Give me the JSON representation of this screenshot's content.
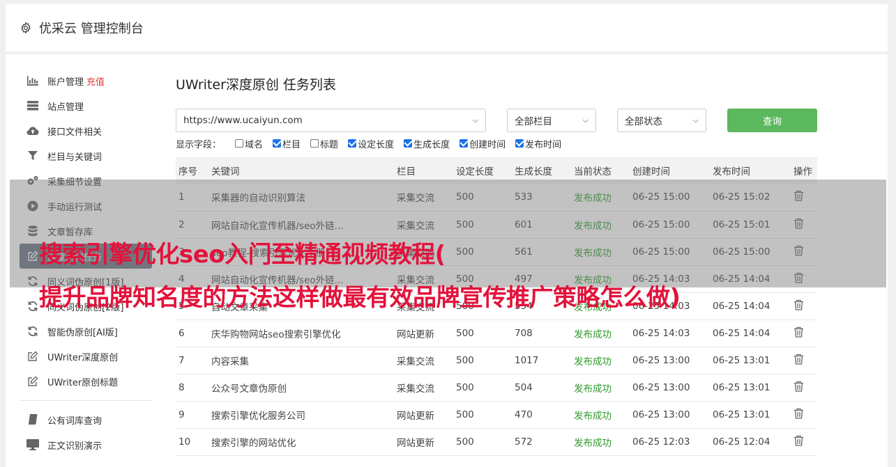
{
  "header": {
    "title": "优采云 管理控制台",
    "icon": "gear-icon"
  },
  "sidebar": {
    "items": [
      {
        "label": "账户管理",
        "extra": "充值",
        "icon": "bar-chart-icon"
      },
      {
        "label": "站点管理",
        "icon": "server-icon"
      },
      {
        "label": "接口文件相关",
        "icon": "cloud-upload-icon"
      },
      {
        "label": "栏目与关键词",
        "icon": "filter-icon"
      },
      {
        "label": "采集细节设置",
        "icon": "gears-icon"
      },
      {
        "label": "手动运行测试",
        "icon": "play-icon"
      },
      {
        "label": "文章暂存库",
        "icon": "database-icon"
      },
      {
        "label": "深度原创任务",
        "icon": "edit-icon",
        "active": true
      },
      {
        "label": "同义词伪原创[1版]",
        "icon": "refresh-icon"
      },
      {
        "label": "同义词伪原创[2版]",
        "icon": "refresh-icon"
      },
      {
        "label": "智能伪原创[AI版]",
        "icon": "refresh-icon"
      },
      {
        "label": "UWriter深度原创",
        "icon": "edit-icon"
      },
      {
        "label": "UWriter原创标题",
        "icon": "edit-icon"
      },
      {
        "label": "公有词库查询",
        "icon": "book-icon"
      },
      {
        "label": "正文识别演示",
        "icon": "monitor-icon"
      }
    ]
  },
  "main": {
    "title": "UWriter深度原创 任务列表",
    "site_select": "https://www.ucaiyun.com",
    "column_select": "全部栏目",
    "status_select": "全部状态",
    "query_label": "查询",
    "fields_label": "显示字段：",
    "fields": [
      {
        "label": "域名",
        "checked": false
      },
      {
        "label": "栏目",
        "checked": true
      },
      {
        "label": "标题",
        "checked": false
      },
      {
        "label": "设定长度",
        "checked": true
      },
      {
        "label": "生成长度",
        "checked": true
      },
      {
        "label": "创建时间",
        "checked": true
      },
      {
        "label": "发布时间",
        "checked": true
      }
    ],
    "columns": [
      "序号",
      "关键词",
      "栏目",
      "设定长度",
      "生成长度",
      "当前状态",
      "创建时间",
      "发布时间",
      "操作"
    ],
    "rows": [
      [
        "1",
        "采集器的自动识别算法",
        "采集交流",
        "500",
        "533",
        "发布成功",
        "06-25 15:00",
        "06-25 15:02"
      ],
      [
        "2",
        "网站自动化宣传机器/seo外链...",
        "采集交流",
        "500",
        "601",
        "发布成功",
        "06-25 15:00",
        "06-25 15:01"
      ],
      [
        "3",
        "seo教程-搜索引擎优化手册",
        "采集交流",
        "500",
        "561",
        "发布成功",
        "06-25 15:00",
        "06-25 15:00"
      ],
      [
        "4",
        "网站自动化宣传机器/seo外链...",
        "采集交流",
        "500",
        "497",
        "发布成功",
        "06-25 14:03",
        "06-25 14:04"
      ],
      [
        "5",
        "自动文章采集",
        "采集交流",
        "500",
        "554",
        "发布成功",
        "06-25 14:03",
        "06-25 14:04"
      ],
      [
        "6",
        "庆华购物网站seo搜索引擎优化",
        "网站更新",
        "500",
        "708",
        "发布成功",
        "06-25 14:03",
        "06-25 14:04"
      ],
      [
        "7",
        "内容采集",
        "采集交流",
        "500",
        "1017",
        "发布成功",
        "06-25 13:00",
        "06-25 13:01"
      ],
      [
        "8",
        "公众号文章伪原创",
        "采集交流",
        "500",
        "504",
        "发布成功",
        "06-25 13:00",
        "06-25 13:01"
      ],
      [
        "9",
        "搜索引擎优化服务公司",
        "网站更新",
        "500",
        "470",
        "发布成功",
        "06-25 13:00",
        "06-25 13:01"
      ],
      [
        "10",
        "搜索引擎的网站优化",
        "网站更新",
        "500",
        "572",
        "发布成功",
        "06-25 12:03",
        "06-25 12:04"
      ]
    ]
  },
  "overlay": {
    "line1": "搜索引擎优化seo入门至精通视频教程(",
    "line2": "提升品牌知名度的方法这样做最有效品牌宣传推广策略怎么做)"
  }
}
